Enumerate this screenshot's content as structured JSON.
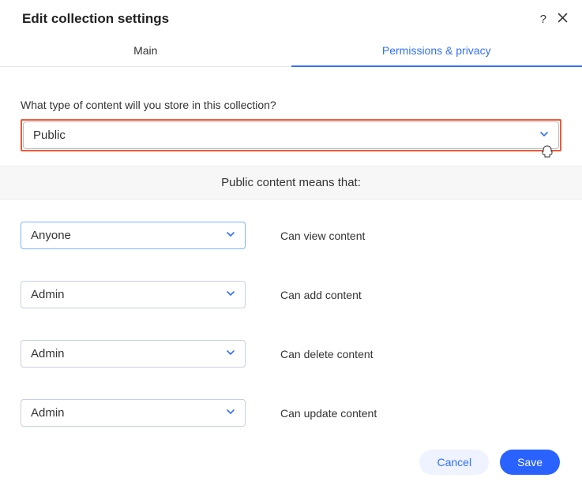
{
  "header": {
    "title": "Edit collection settings"
  },
  "tabs": {
    "main": "Main",
    "permissions": "Permissions & privacy"
  },
  "question": "What type of content will you store in this collection?",
  "typeSelect": {
    "value": "Public"
  },
  "infoBand": "Public content means that:",
  "permissions": [
    {
      "role": "Anyone",
      "label": "Can view content",
      "highlight": true
    },
    {
      "role": "Admin",
      "label": "Can add content",
      "highlight": false
    },
    {
      "role": "Admin",
      "label": "Can delete content",
      "highlight": false
    },
    {
      "role": "Admin",
      "label": "Can update content",
      "highlight": false
    }
  ],
  "footer": {
    "cancel": "Cancel",
    "save": "Save"
  }
}
